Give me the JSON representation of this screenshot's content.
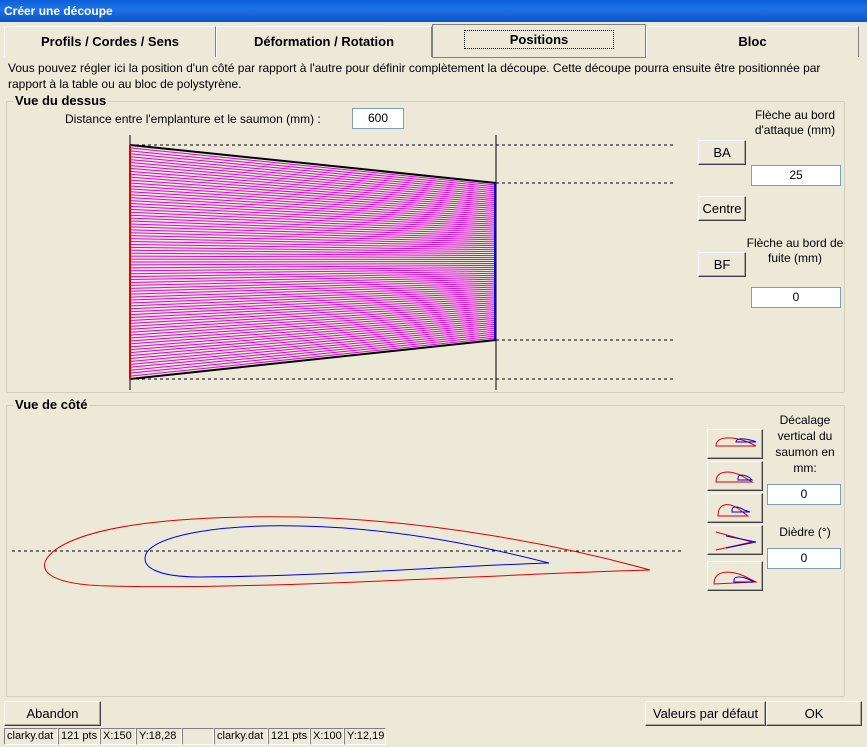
{
  "window": {
    "title": "Créer une découpe"
  },
  "tabs": [
    {
      "label": "Profils / Cordes / Sens"
    },
    {
      "label": "Déformation / Rotation"
    },
    {
      "label": "Positions"
    },
    {
      "label": "Bloc"
    }
  ],
  "info_text": "Vous pouvez régler ici la position d'un côté par rapport à l'autre pour définir complètement la découpe. Cette découpe pourra ensuite être positionnée par rapport à la table ou au bloc de polystyrène.",
  "top_view": {
    "title": "Vue du dessus",
    "distance_label": "Distance entre l'emplanture et le saumon (mm) :",
    "distance_value": "600",
    "leading_edge_label": "Flèche au bord d'attaque (mm)",
    "leading_edge_value": "25",
    "trailing_edge_label": "Flèche au bord de fuite (mm)",
    "trailing_edge_value": "0",
    "ba_button": "BA",
    "centre_button": "Centre",
    "bf_button": "BF"
  },
  "side_view": {
    "title": "Vue de côté",
    "offset_label": "Décalage vertical du saumon en mm:",
    "offset_value": "0",
    "dihedral_label": "Dièdre (°)",
    "dihedral_value": "0",
    "align_icons": [
      "align-leading-edge-icon",
      "align-trailing-edge-icon",
      "align-center-icon",
      "align-chord-icon",
      "align-bottom-icon"
    ]
  },
  "buttons": {
    "cancel": "Abandon",
    "defaults": "Valeurs par défaut",
    "ok": "OK"
  },
  "status": {
    "left_file": "clarky.dat",
    "left_pts": "121 pts",
    "left_x": "X:150",
    "left_y": "Y:18,28",
    "right_file": "clarky.dat",
    "right_pts": "121 pts",
    "right_x": "X:100",
    "right_y": "Y:12,19"
  },
  "colors": {
    "root": "#e00000",
    "tip": "#0000e0",
    "hatch": "#e000e0",
    "titlebar": "#0a5fd8"
  }
}
